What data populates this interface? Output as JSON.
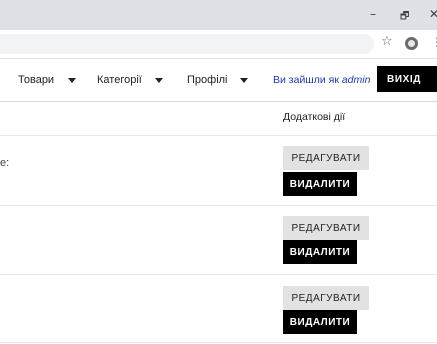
{
  "window": {
    "minimize_glyph": "–",
    "restore_glyph": "🗗",
    "close_glyph": "✕"
  },
  "toolbar": {
    "bookmark_icon": "star-icon",
    "menu_icon": "kebab-icon"
  },
  "nav": {
    "products_label": "Товари",
    "categories_label": "Категорії",
    "profiles_label": "Профілі",
    "logged_in_prefix": "Ви зайшли як",
    "logged_in_user": "admin",
    "logout_label": "ВИХІД"
  },
  "table": {
    "actions_header": "Додаткові дії",
    "rows": [
      {
        "fragment": "e:",
        "edit_label": "РЕДАГУВАТИ",
        "delete_label": "ВИДАЛИТИ"
      },
      {
        "fragment": "",
        "edit_label": "РЕДАГУВАТИ",
        "delete_label": "ВИДАЛИТИ"
      },
      {
        "fragment": "",
        "edit_label": "РЕДАГУВАТИ",
        "delete_label": "ВИДАЛИТИ"
      }
    ]
  },
  "colors": {
    "titlebar": "#dee1e6",
    "logged_in_text": "#1a3db3",
    "primary_button": "#000000",
    "secondary_button": "#e2e2e2"
  }
}
